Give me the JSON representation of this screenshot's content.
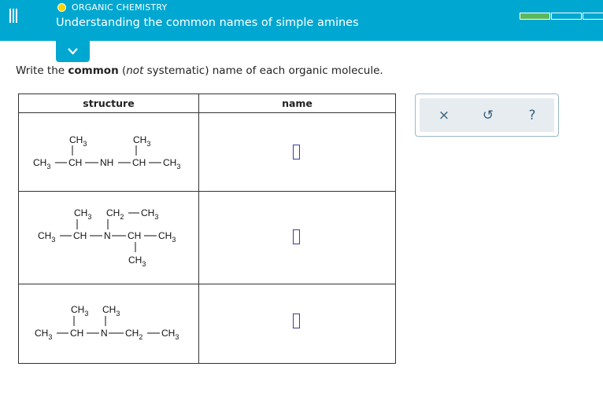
{
  "header": {
    "category": "ORGANIC CHEMISTRY",
    "topic": "Understanding the common names of simple amines",
    "colors": {
      "bar": "#00a7d1",
      "progress_fill": "#5cb85c",
      "category_dot": "#ffd200"
    }
  },
  "icons": {
    "menu": "hamburger-icon",
    "collapse": "chevron-down-icon",
    "clear": "x-icon",
    "undo": "undo-icon",
    "help": "question-icon"
  },
  "prompt": {
    "before": "Write the ",
    "bold": "common",
    "mid1": " (",
    "italic": "not",
    "after": " systematic) name of each organic molecule."
  },
  "table": {
    "headers": {
      "structure": "structure",
      "name": "name"
    },
    "rows": [
      {
        "labels": {
          "s1": "CH3",
          "s2": "CH3",
          "m1": "CH3",
          "m2": "CH",
          "m3": "NH",
          "m4": "CH",
          "m5": "CH3"
        },
        "answer": ""
      },
      {
        "labels": {
          "t1": "CH3",
          "t2": "CH2",
          "t3": "CH3",
          "m1": "CH3",
          "m2": "CH",
          "m3": "N",
          "m4": "CH",
          "m5": "CH3",
          "b1": "CH3"
        },
        "answer": ""
      },
      {
        "labels": {
          "t1": "CH3",
          "t2": "CH3",
          "m1": "CH3",
          "m2": "CH",
          "m3": "N",
          "m4": "CH2",
          "m5": "CH3"
        },
        "answer": ""
      }
    ]
  },
  "tools": {
    "clear": "×",
    "undo": "↺",
    "help": "?"
  }
}
